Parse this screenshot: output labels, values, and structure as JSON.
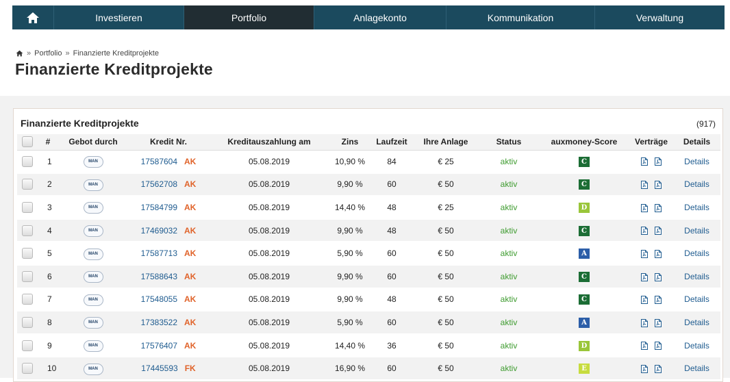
{
  "nav": {
    "items": [
      {
        "label": "Investieren",
        "active": false
      },
      {
        "label": "Portfolio",
        "active": true
      },
      {
        "label": "Anlagekonto",
        "active": false
      },
      {
        "label": "Kommunikation",
        "active": false
      },
      {
        "label": "Verwaltung",
        "active": false
      }
    ]
  },
  "breadcrumb": {
    "separator": "»",
    "items": [
      "Portfolio",
      "Finanzierte Kreditprojekte"
    ]
  },
  "page_title": "Finanzierte Kreditprojekte",
  "panel": {
    "title": "Finanzierte Kreditprojekte",
    "count": "(917)"
  },
  "table": {
    "headers": [
      "#",
      "Gebot durch",
      "Kredit Nr.",
      "Kreditauszahlung am",
      "Zins",
      "Laufzeit",
      "Ihre Anlage",
      "Status",
      "auxmoney-Score",
      "Verträge",
      "Details"
    ],
    "rows": [
      {
        "n": "1",
        "bid": "MAN",
        "kredit": "17587604",
        "type": "AK",
        "date": "05.08.2019",
        "zins": "10,90 %",
        "laufzeit": "84",
        "anlage": "€ 25",
        "status": "aktiv",
        "score": "C",
        "details": "Details"
      },
      {
        "n": "2",
        "bid": "MAN",
        "kredit": "17562708",
        "type": "AK",
        "date": "05.08.2019",
        "zins": "9,90 %",
        "laufzeit": "60",
        "anlage": "€ 50",
        "status": "aktiv",
        "score": "C",
        "details": "Details"
      },
      {
        "n": "3",
        "bid": "MAN",
        "kredit": "17584799",
        "type": "AK",
        "date": "05.08.2019",
        "zins": "14,40 %",
        "laufzeit": "48",
        "anlage": "€ 25",
        "status": "aktiv",
        "score": "D",
        "details": "Details"
      },
      {
        "n": "4",
        "bid": "MAN",
        "kredit": "17469032",
        "type": "AK",
        "date": "05.08.2019",
        "zins": "9,90 %",
        "laufzeit": "48",
        "anlage": "€ 50",
        "status": "aktiv",
        "score": "C",
        "details": "Details"
      },
      {
        "n": "5",
        "bid": "MAN",
        "kredit": "17587713",
        "type": "AK",
        "date": "05.08.2019",
        "zins": "5,90 %",
        "laufzeit": "60",
        "anlage": "€ 50",
        "status": "aktiv",
        "score": "A",
        "details": "Details"
      },
      {
        "n": "6",
        "bid": "MAN",
        "kredit": "17588643",
        "type": "AK",
        "date": "05.08.2019",
        "zins": "9,90 %",
        "laufzeit": "60",
        "anlage": "€ 50",
        "status": "aktiv",
        "score": "C",
        "details": "Details"
      },
      {
        "n": "7",
        "bid": "MAN",
        "kredit": "17548055",
        "type": "AK",
        "date": "05.08.2019",
        "zins": "9,90 %",
        "laufzeit": "48",
        "anlage": "€ 50",
        "status": "aktiv",
        "score": "C",
        "details": "Details"
      },
      {
        "n": "8",
        "bid": "MAN",
        "kredit": "17383522",
        "type": "AK",
        "date": "05.08.2019",
        "zins": "5,90 %",
        "laufzeit": "60",
        "anlage": "€ 50",
        "status": "aktiv",
        "score": "A",
        "details": "Details"
      },
      {
        "n": "9",
        "bid": "MAN",
        "kredit": "17576407",
        "type": "AK",
        "date": "05.08.2019",
        "zins": "14,40 %",
        "laufzeit": "36",
        "anlage": "€ 50",
        "status": "aktiv",
        "score": "D",
        "details": "Details"
      },
      {
        "n": "10",
        "bid": "MAN",
        "kredit": "17445593",
        "type": "FK",
        "date": "05.08.2019",
        "zins": "16,90 %",
        "laufzeit": "60",
        "anlage": "€ 50",
        "status": "aktiv",
        "score": "E",
        "details": "Details"
      }
    ]
  },
  "colors": {
    "nav_bg": "#1b4a5e",
    "nav_active": "#212d33",
    "type_ak": "#e0632a",
    "status_aktiv": "#3e9b2f",
    "score_A": "#2c5ea8",
    "score_C": "#1c6d35",
    "score_D": "#9ac63a",
    "score_E": "#c7dc3e"
  },
  "icons": {
    "home": "home-icon",
    "contract": "pdf-file-icon"
  }
}
